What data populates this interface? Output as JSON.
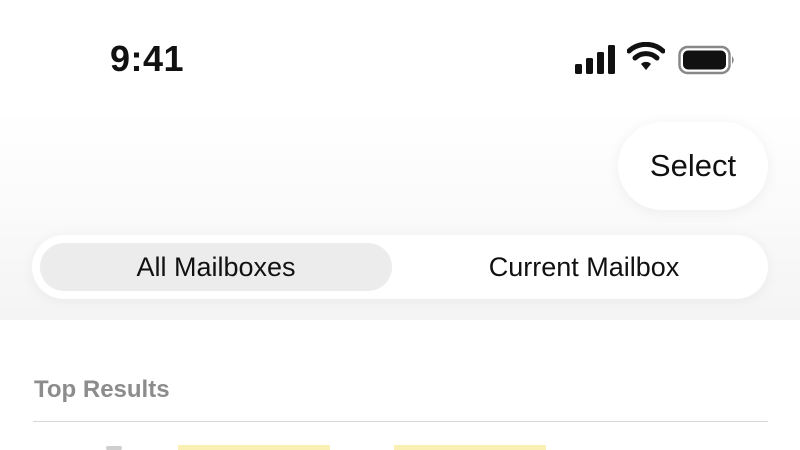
{
  "status_bar": {
    "time": "9:41",
    "cellular_icon": "cellular-signal-icon",
    "wifi_icon": "wifi-icon",
    "battery_icon": "battery-icon"
  },
  "toolbar": {
    "select_label": "Select"
  },
  "scope": {
    "options": [
      "All Mailboxes",
      "Current Mailbox"
    ],
    "selected": "All Mailboxes"
  },
  "results": {
    "section_title": "Top Results"
  },
  "colors": {
    "search_highlight": "#fbf0b4",
    "segment_selected": "#ececec",
    "section_heading": "#8c8c8c"
  }
}
